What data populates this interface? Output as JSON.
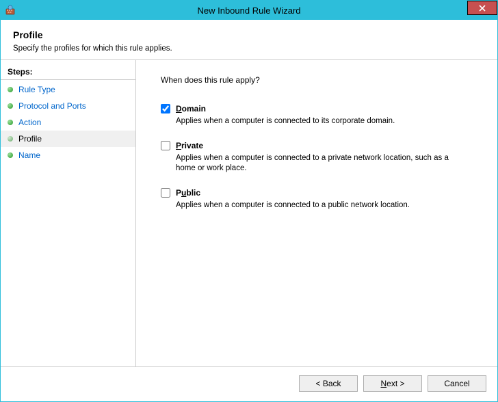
{
  "window": {
    "title": "New Inbound Rule Wizard"
  },
  "header": {
    "title": "Profile",
    "subtitle": "Specify the profiles for which this rule applies."
  },
  "sidebar": {
    "title": "Steps:",
    "items": [
      {
        "label": "Rule Type",
        "active": false
      },
      {
        "label": "Protocol and Ports",
        "active": false
      },
      {
        "label": "Action",
        "active": false
      },
      {
        "label": "Profile",
        "active": true
      },
      {
        "label": "Name",
        "active": false
      }
    ]
  },
  "content": {
    "question": "When does this rule apply?",
    "options": [
      {
        "key": "domain",
        "accel": "D",
        "rest": "omain",
        "checked": true,
        "desc": "Applies when a computer is connected to its corporate domain."
      },
      {
        "key": "private",
        "accel": "P",
        "rest": "rivate",
        "checked": false,
        "desc": "Applies when a computer is connected to a private network location, such as a home or work place."
      },
      {
        "key": "public",
        "accel": "P",
        "full": "Public",
        "u_index": 1,
        "checked": false,
        "desc": "Applies when a computer is connected to a public network location."
      }
    ]
  },
  "footer": {
    "back": "< Back",
    "next": "Next >",
    "cancel": "Cancel"
  }
}
